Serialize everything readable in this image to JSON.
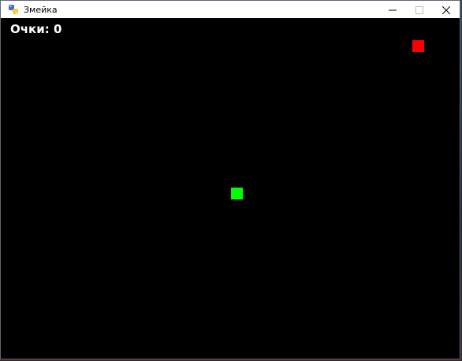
{
  "window": {
    "title": "Змейка",
    "app_icon": "python-icon",
    "controls": {
      "minimize_icon": "minimize-icon",
      "maximize_icon": "maximize-icon",
      "close_icon": "close-icon"
    }
  },
  "game": {
    "score_text": "Очки: 0",
    "colors": {
      "background": "#000000",
      "snake": "#00ff00",
      "food": "#ff0000",
      "text": "#ffffff"
    }
  }
}
